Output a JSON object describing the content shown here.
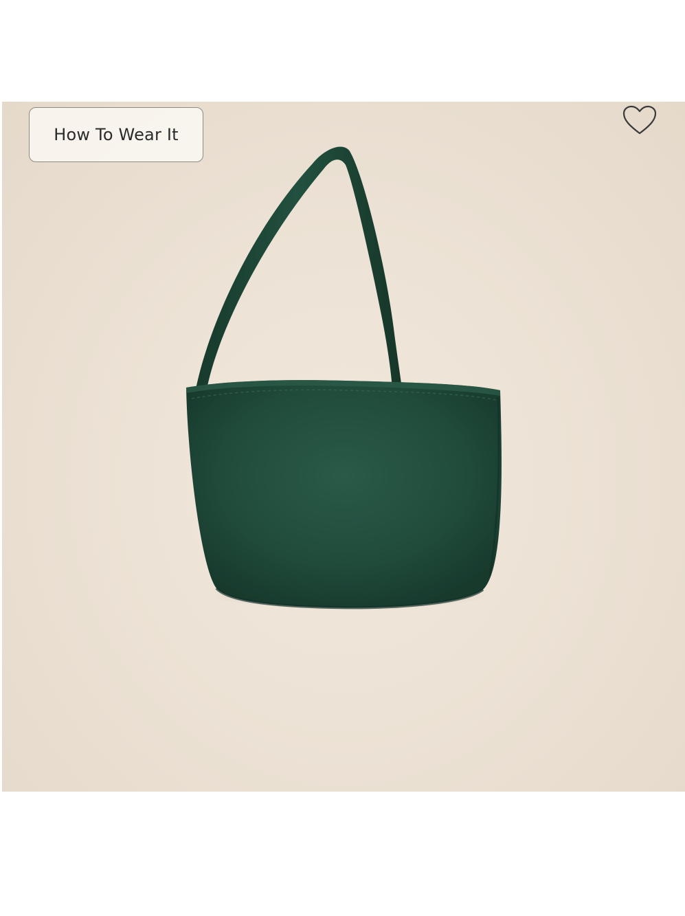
{
  "product_gallery": {
    "how_to_wear_label": "How To Wear It",
    "favorite_icon": "heart-outline-icon",
    "background_color": "#ece2d5",
    "bag_color": "#1f4a3a"
  }
}
